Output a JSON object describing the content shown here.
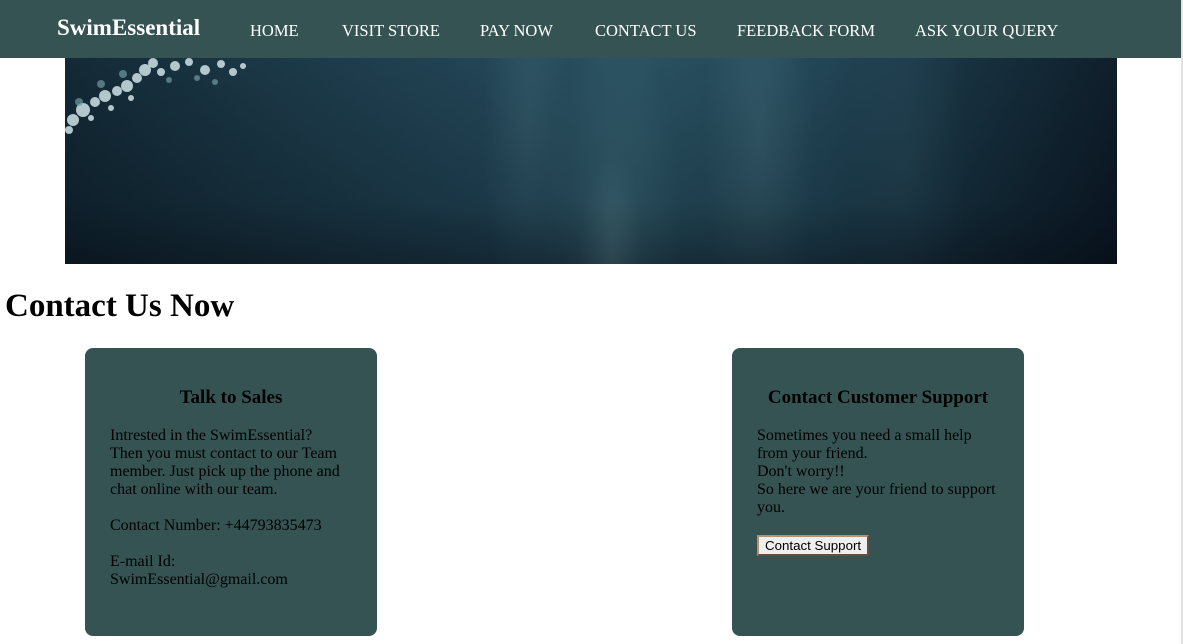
{
  "navbar": {
    "brand": "SwimEssential",
    "items": [
      {
        "label": "HOME"
      },
      {
        "label": "VISIT STORE"
      },
      {
        "label": "PAY NOW"
      },
      {
        "label": "CONTACT US"
      },
      {
        "label": "FEEDBACK FORM"
      },
      {
        "label": "ASK YOUR QUERY"
      }
    ]
  },
  "hero": {
    "image": "underwater-banner"
  },
  "main": {
    "title": "Contact Us Now"
  },
  "sales_card": {
    "title": "Talk to Sales",
    "line1": "Intrested in the SwimEssential?",
    "line2": "Then you must contact to our Team member. Just pick up the phone and chat online with our team.",
    "contact_number": "Contact Number: +44793835473",
    "email_label": "E-mail Id:",
    "email": "SwimEssential@gmail.com"
  },
  "support_card": {
    "title": "Contact Customer Support",
    "line1": "Sometimes you need a small help from your friend.",
    "line2": "Don't worry!!",
    "line3": "So here we are your friend to support you.",
    "button_label": "Contact Support"
  },
  "colors": {
    "nav_background": "#345352",
    "card_background": "#345352",
    "nav_text": "#ffffff"
  }
}
